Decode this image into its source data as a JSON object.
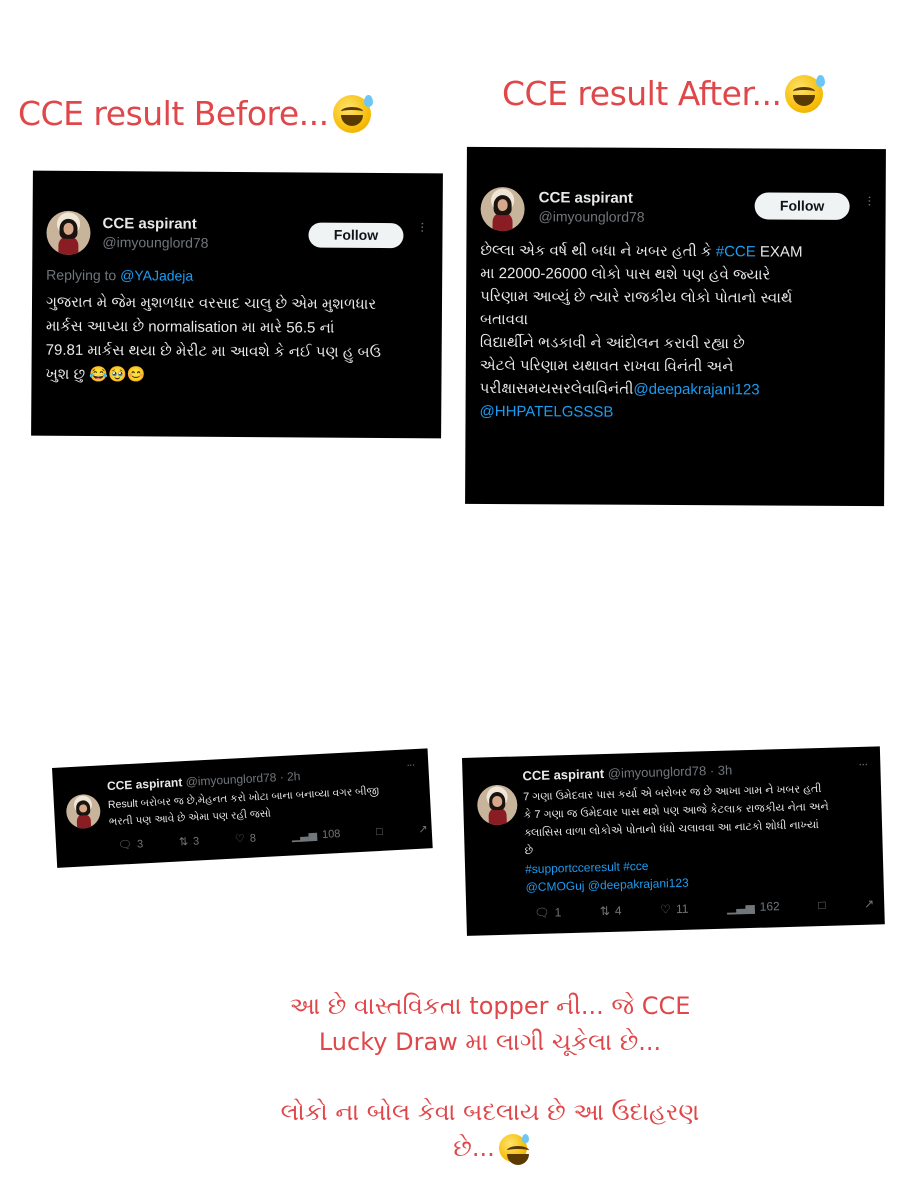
{
  "headings": {
    "before": "CCE result Before...",
    "after": "CCE result After..."
  },
  "tweet1": {
    "name": "CCE aspirant",
    "handle": "@imyounglord78",
    "follow": "Follow",
    "replying_prefix": "Replying to ",
    "replying_to": "@YAJadeja",
    "text": "ગુજરાત મે જેમ મુશળધાર વરસાદ ચાલુ છે એમ મુશળધાર\nમાર્કસ આપ્યા છે normalisation મા મારે 56.5 નાં\n79.81 માર્કસ થયા છે મેરીટ મા આવશે કે નઈ પણ હુ બઉ\nખુશ છુ 😂🥹😊"
  },
  "tweet2": {
    "name": "CCE aspirant",
    "handle": "@imyounglord78",
    "follow": "Follow",
    "text_part1": "છેલ્લા એક વર્ષ થી બધા ને ખબર હતી કે ",
    "hashtag": "#CCE",
    "text_part2": " EXAM\nમા 22000-26000 લોકો પાસ થશે પણ હવે જ્યારે\nપરિણામ આવ્યું છે ત્યારે રાજકીય લોકો પોતાનો સ્વાર્થ\nબતાવવા\nવિદ્યાર્થીને ભડકાવી ને આંદોલન કરાવી રહ્યા છે\nએટલે પરિણામ યથાવત રાખવા વિનંતી અને\nપરીક્ષાસમયસરલેવાવિનંતી",
    "mention1": "@deepakrajani123",
    "mention2": "@HHPATELGSSSB"
  },
  "tweet3": {
    "name": "CCE aspirant",
    "handle": "@imyounglord78",
    "time": "· 2h",
    "text": "Result બરોબર જ છે,મેહનત કરો ખોટા બાના બનાવ્યા વગર બીજી\nભરતી પણ આવે છે એમા પણ રહી જસો",
    "replies": "3",
    "reposts": "3",
    "likes": "8",
    "views": "108"
  },
  "tweet4": {
    "name": "CCE aspirant",
    "handle": "@imyounglord78",
    "time": "· 3h",
    "text": "7 ગણા ઉમેદવાર પાસ કર્યા એ બરોબર જ છે આખા ગામ ને ખબર હતી\nકે 7 ગણા જ ઉમેદવાર પાસ થશે પણ આજે કેટલાક રાજકીય નેતા અને\nક્લાસિસ વાળા લોકોએ પોતાનો ધંધો ચલાવવા આ નાટકો શોધી નાખ્યાં\nછે",
    "hashtags": "#supportcceresult #cce",
    "mentions": "@CMOGuj @deepakrajani123",
    "replies": "1",
    "reposts": "4",
    "likes": "11",
    "views": "162"
  },
  "caption": {
    "line1": "આ છે વાસ્તવિકતા topper ની... જે CCE",
    "line2": "Lucky Draw મા લાગી ચૂકેલા છે...",
    "line3": "લોકો ના બોલ કેવા બદલાય છે આ ઉદાહરણ",
    "line4": "છે..."
  },
  "icons": [
    "grinning-sweat-emoji",
    "reply-icon",
    "repost-icon",
    "like-icon",
    "views-icon",
    "bookmark-icon",
    "share-icon",
    "more-icon"
  ],
  "colors": {
    "heading": "#e0474a",
    "link": "#1d9bf0",
    "card_bg": "#000000",
    "muted": "#71767b"
  }
}
